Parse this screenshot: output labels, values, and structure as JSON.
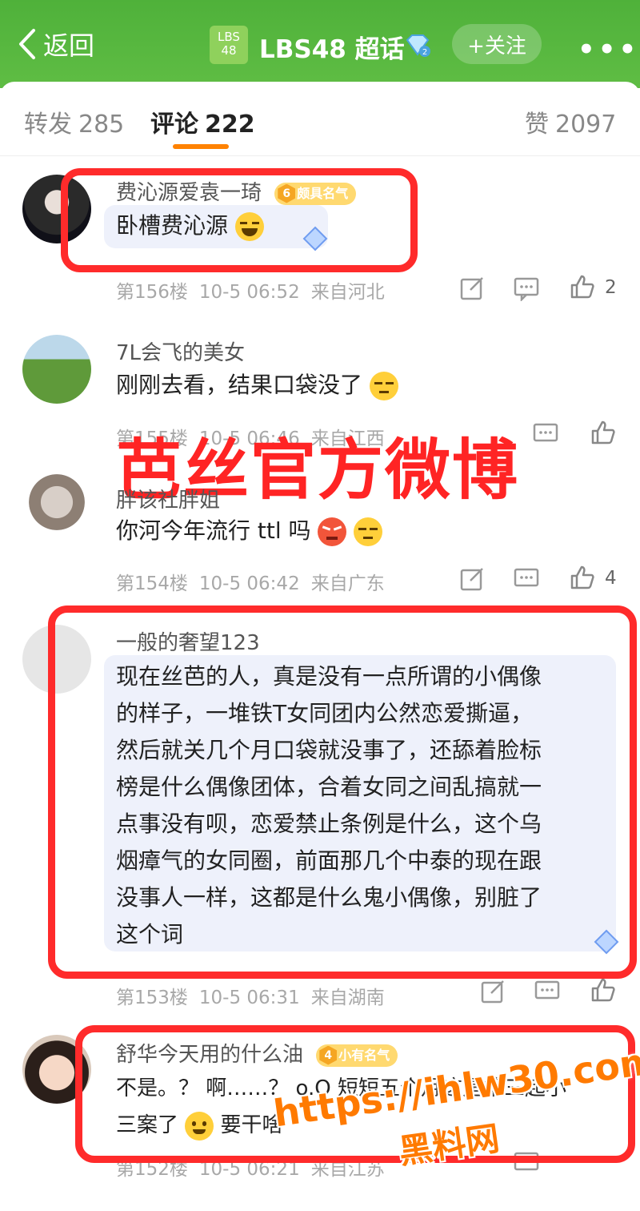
{
  "header": {
    "back_label": "返回",
    "logo_text_line1": "LBS",
    "logo_text_line2": "48",
    "title": "LBS48 超话",
    "follow_label": "+关注",
    "more_label": "•••"
  },
  "tabs": [
    {
      "label": "转发",
      "count": "285"
    },
    {
      "label": "评论",
      "count": "222"
    },
    {
      "label": "赞",
      "count": "2097"
    }
  ],
  "comments": [
    {
      "username": "费沁源爱袁一琦",
      "badge_level": "6",
      "badge_text": "颇具名气",
      "text": "卧槽费沁源",
      "floor": "第156楼",
      "time": "10-5 06:52",
      "location": "来自河北",
      "likes": "2"
    },
    {
      "username": "7L会飞的美女",
      "text": "刚刚去看，结果口袋没了",
      "floor": "第155楼",
      "time": "10-5 06:46",
      "location": "来自江西",
      "likes": ""
    },
    {
      "username": "胖该社胖姐",
      "text": "你河今年流行 ttl 吗",
      "floor": "第154楼",
      "time": "10-5 06:42",
      "location": "来自广东",
      "likes": "4"
    },
    {
      "username": "一般的奢望123",
      "lines": [
        "现在丝芭的人，真是没有一点所谓的小偶像",
        "的样子，一堆铁T女同团内公然恋爱撕逼，",
        "然后就关几个月口袋就没事了，还舔着脸标",
        "榜是什么偶像团体，合着女同之间乱搞就一",
        "点事没有呗，恋爱禁止条例是什么，这个乌",
        "烟瘴气的女同圈，前面那几个中泰的现在跟",
        "没事人一样，这都是什么鬼小偶像，别脏了",
        "这个词"
      ],
      "floor": "第153楼",
      "time": "10-5 06:31",
      "location": "来自湖南",
      "likes": ""
    },
    {
      "username": "舒华今天用的什么油",
      "badge_level": "4",
      "badge_text": "小有名气",
      "line1": "不是。？ 啊……？ o.O 短短五个月这是第三起小",
      "line2": "三案了",
      "line2_tail": "要干啥",
      "floor": "第152楼",
      "time": "10-5 06:21",
      "location": "来自江苏",
      "likes": ""
    }
  ],
  "overlay": {
    "big_text": "芭丝官方微博",
    "watermark_url": "https://ihlw30.com",
    "watermark_name": "黑料网"
  },
  "colors": {
    "header_green": "#4fb13a",
    "tab_underline": "#ff8200",
    "highlight_red": "#ff2b2b",
    "watermark_orange": "#ff7a00"
  }
}
